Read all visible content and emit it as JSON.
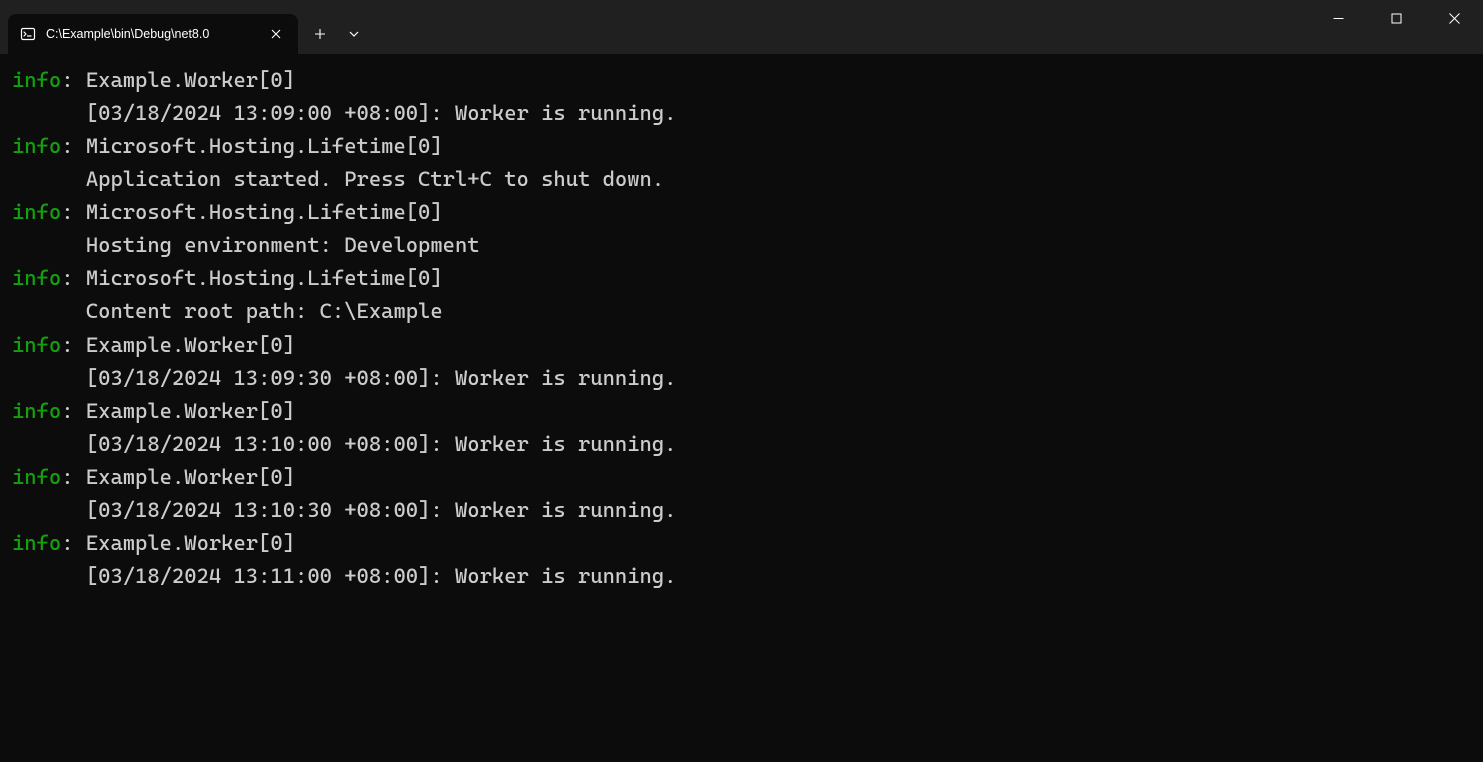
{
  "titlebar": {
    "tab": {
      "title": "C:\\Example\\bin\\Debug\\net8.0"
    }
  },
  "logs": [
    {
      "level": "info",
      "sep": ": ",
      "source": "Example.Worker[0]",
      "message": "[03/18/2024 13:09:00 +08:00]: Worker is running."
    },
    {
      "level": "info",
      "sep": ": ",
      "source": "Microsoft.Hosting.Lifetime[0]",
      "message": "Application started. Press Ctrl+C to shut down."
    },
    {
      "level": "info",
      "sep": ": ",
      "source": "Microsoft.Hosting.Lifetime[0]",
      "message": "Hosting environment: Development"
    },
    {
      "level": "info",
      "sep": ": ",
      "source": "Microsoft.Hosting.Lifetime[0]",
      "message": "Content root path: C:\\Example"
    },
    {
      "level": "info",
      "sep": ": ",
      "source": "Example.Worker[0]",
      "message": "[03/18/2024 13:09:30 +08:00]: Worker is running."
    },
    {
      "level": "info",
      "sep": ": ",
      "source": "Example.Worker[0]",
      "message": "[03/18/2024 13:10:00 +08:00]: Worker is running."
    },
    {
      "level": "info",
      "sep": ": ",
      "source": "Example.Worker[0]",
      "message": "[03/18/2024 13:10:30 +08:00]: Worker is running."
    },
    {
      "level": "info",
      "sep": ": ",
      "source": "Example.Worker[0]",
      "message": "[03/18/2024 13:11:00 +08:00]: Worker is running."
    }
  ]
}
